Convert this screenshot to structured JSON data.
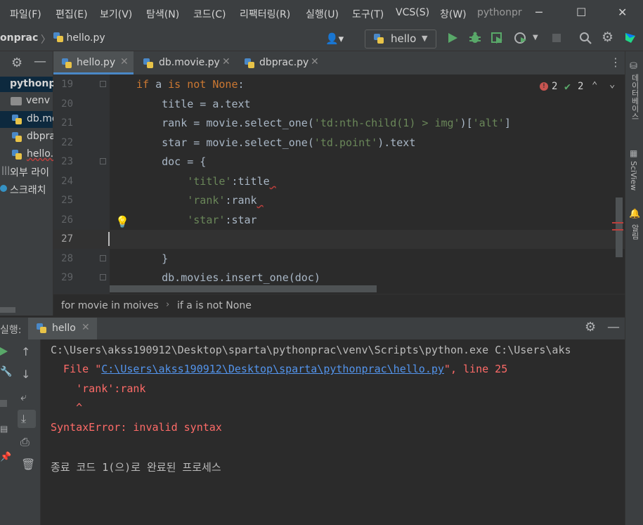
{
  "menu": {
    "items": [
      "파일(F)",
      "편집(E)",
      "보기(V)",
      "탐색(N)",
      "코드(C)",
      "리팩터링(R)",
      "실행(U)",
      "도구(T)",
      "VCS(S)",
      "창(W)"
    ],
    "project_title": "pythonpr"
  },
  "navbar": {
    "project": "onprac",
    "file": "hello.py",
    "run_config": "hello"
  },
  "project_tree": {
    "items": [
      "pythonp",
      "venv",
      "db.mo",
      "dbpra",
      "hello.",
      "외부 라이",
      "스크래치"
    ]
  },
  "tabs": [
    {
      "label": "hello.py",
      "active": true
    },
    {
      "label": "db.movie.py",
      "active": false
    },
    {
      "label": "dbprac.py",
      "active": false
    }
  ],
  "inspection": {
    "errors": "2",
    "warnings": "2"
  },
  "editor": {
    "line_numbers": [
      "19",
      "20",
      "21",
      "22",
      "23",
      "24",
      "25",
      "26",
      "27",
      "28",
      "29"
    ],
    "current_line": "27"
  },
  "breadcrumb": [
    "for movie in moives",
    "if a is not None"
  ],
  "right_tools": [
    "데이터베이스",
    "SciView",
    "알림"
  ],
  "run": {
    "label": "실행:",
    "tab": "hello",
    "console": {
      "line1": "C:\\Users\\akss190912\\Desktop\\sparta\\pythonprac\\venv\\Scripts\\python.exe C:\\Users\\aks",
      "file_prefix": "  File \"",
      "file_path": "C:\\Users\\akss190912\\Desktop\\sparta\\pythonprac\\hello.py",
      "file_suffix": "\", line 25",
      "line3": "    'rank':rank",
      "line4": "    ^",
      "line5": "SyntaxError: invalid syntax",
      "line6": "종료 코드 1(으)로 완료된 프로세스"
    }
  }
}
